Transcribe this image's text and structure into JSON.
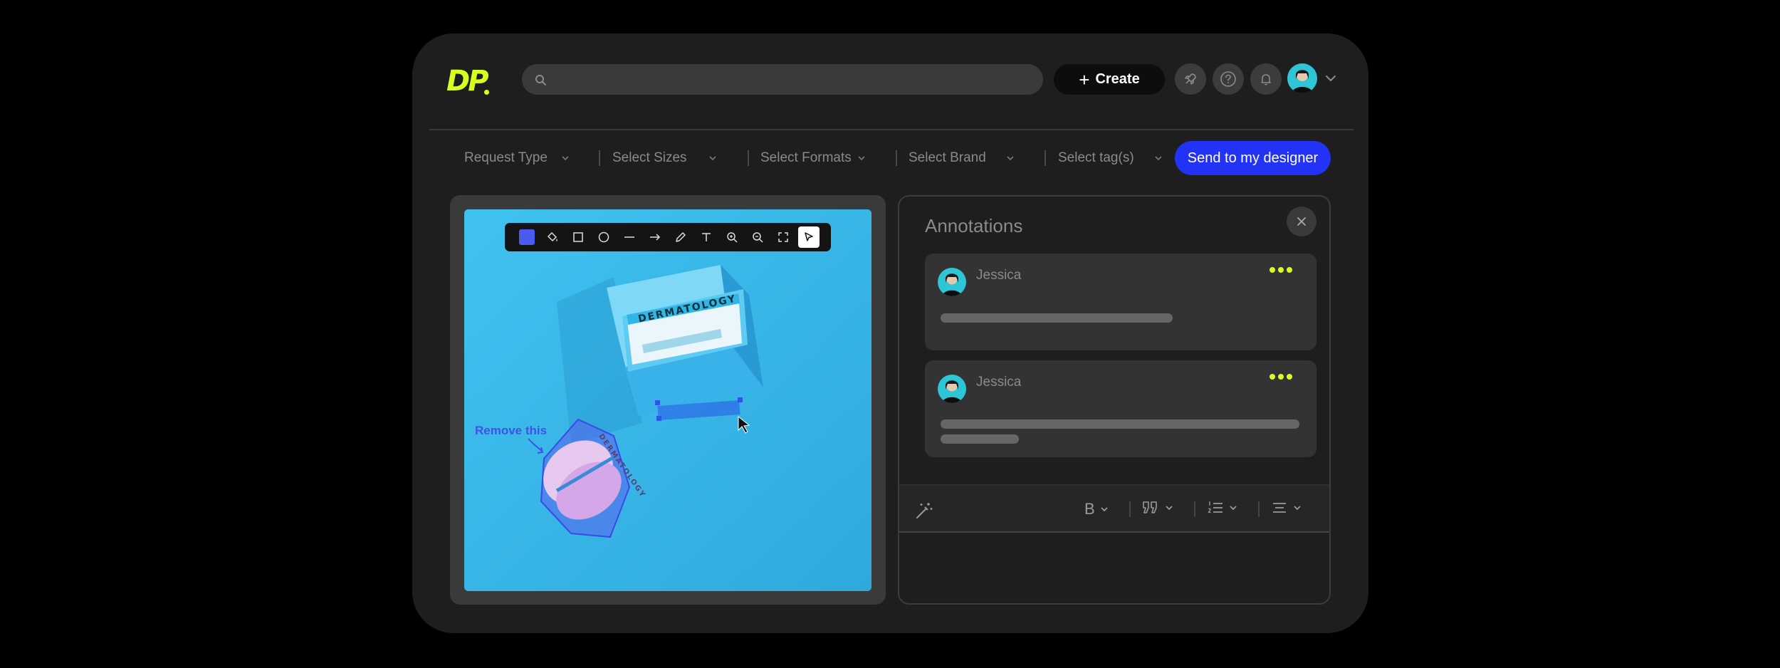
{
  "brand": {
    "logo_text": "DP",
    "accent_color": "#d6ff1f",
    "primary_color": "#2233f5"
  },
  "header": {
    "search_placeholder": "",
    "create_label": "Create",
    "icons": [
      "rocket-icon",
      "help-icon",
      "bell-icon"
    ]
  },
  "filters": [
    {
      "label": "Request Type"
    },
    {
      "label": "Select Sizes"
    },
    {
      "label": "Select Formats"
    },
    {
      "label": "Select Brand"
    },
    {
      "label": "Select tag(s)"
    }
  ],
  "send_button_label": "Send to my designer",
  "canvas": {
    "toolbar_tools": [
      "color-swatch",
      "fill-icon",
      "rectangle-icon",
      "ellipse-icon",
      "line-icon",
      "arrow-icon",
      "pen-icon",
      "text-icon",
      "zoom-in-icon",
      "zoom-out-icon",
      "fit-screen-icon",
      "select-cursor-icon"
    ],
    "active_color": "#4b5af0",
    "box_brand_text": "DERMATOLOGY",
    "jar_brand_text": "DERMATOLOGY",
    "annotation_label": "Remove this"
  },
  "annotations": {
    "title": "Annotations",
    "comments": [
      {
        "author": "Jessica"
      },
      {
        "author": "Jessica"
      }
    ]
  },
  "editor_toolbar": {
    "bold_label": "B",
    "icons": [
      "magic-wand-icon",
      "bold-icon",
      "quote-icon",
      "numbered-list-icon",
      "align-icon"
    ]
  }
}
